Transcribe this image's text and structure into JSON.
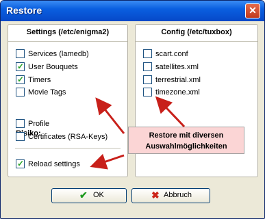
{
  "window": {
    "title": "Restore",
    "close_glyph": "✕"
  },
  "settings": {
    "header": "Settings (/etc/enigma2)",
    "items": [
      {
        "label": "Services (lamedb)",
        "checked": false
      },
      {
        "label": "User Bouquets",
        "checked": true
      },
      {
        "label": "Timers",
        "checked": true
      },
      {
        "label": "Movie Tags",
        "checked": false
      }
    ],
    "risk_label": "Risiko:",
    "risk_items": [
      {
        "label": "Profile",
        "checked": false
      },
      {
        "label": "Certificates (RSA-Keys)",
        "checked": false
      }
    ],
    "reload": {
      "label": "Reload settings",
      "checked": true
    }
  },
  "config": {
    "header": "Config (/etc/tuxbox)",
    "items": [
      {
        "label": "scart.conf",
        "checked": false
      },
      {
        "label": "satellites.xml",
        "checked": false
      },
      {
        "label": "terrestrial.xml",
        "checked": false
      },
      {
        "label": "timezone.xml",
        "checked": false
      }
    ]
  },
  "buttons": {
    "ok": "OK",
    "cancel": "Abbruch"
  },
  "callout": {
    "line1": "Restore mit diversen",
    "line2": "Auswahlmöglichkeiten"
  },
  "colors": {
    "titlebar": "#0a5fe0",
    "callout_bg": "#fbd5d5",
    "arrow": "#c8201a",
    "check": "#21a121"
  }
}
